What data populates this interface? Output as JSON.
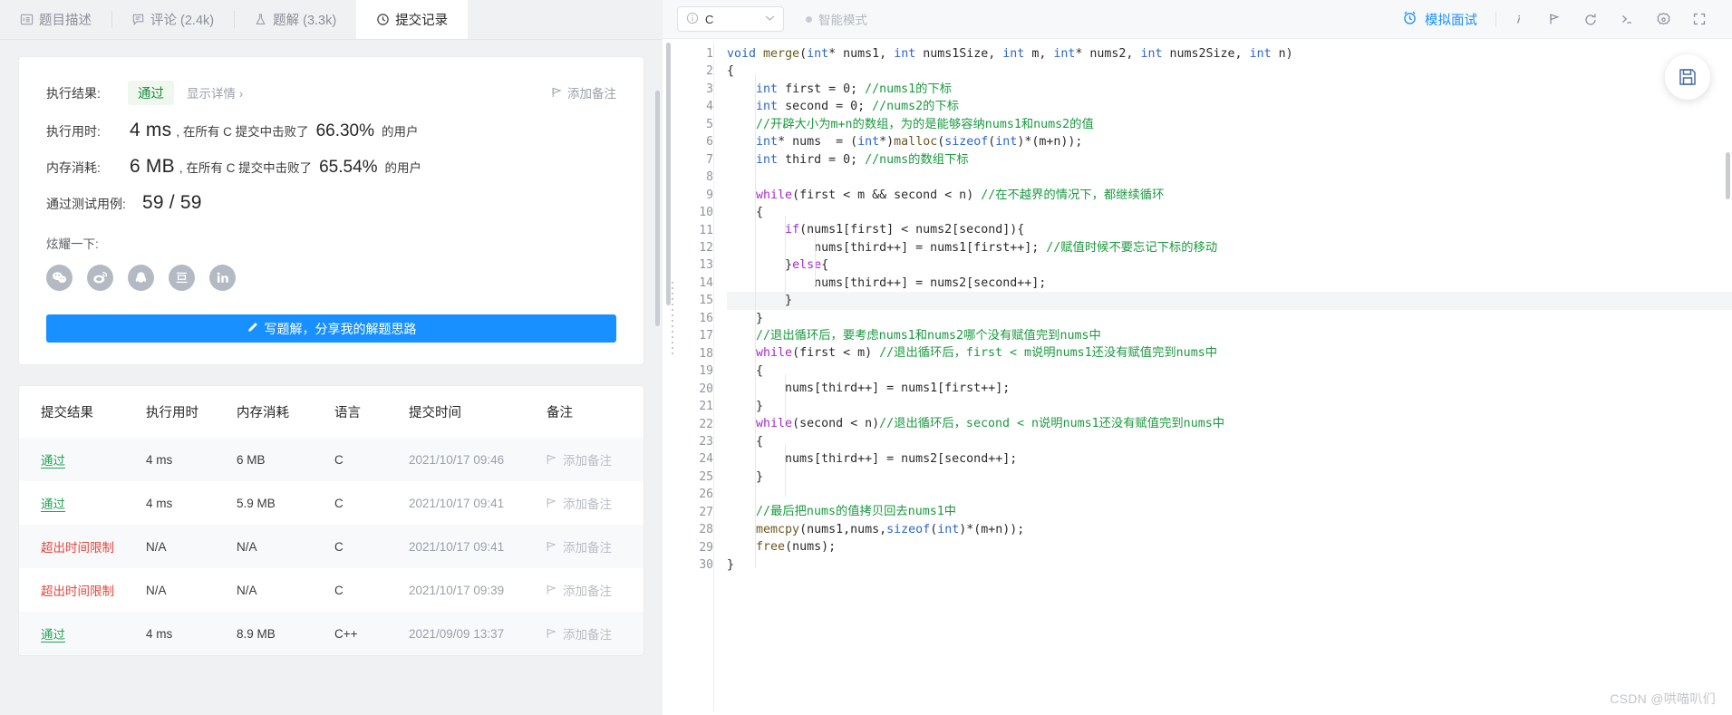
{
  "tabs": [
    {
      "label": "题目描述",
      "icon": "description-icon",
      "active": false
    },
    {
      "label": "评论 (2.4k)",
      "icon": "comment-icon",
      "active": false
    },
    {
      "label": "题解 (3.3k)",
      "icon": "flask-icon",
      "active": false
    },
    {
      "label": "提交记录",
      "icon": "clock-icon",
      "active": true
    }
  ],
  "result": {
    "exec_result_label": "执行结果:",
    "status": "通过",
    "show_detail": "显示详情 ›",
    "add_note": "添加备注",
    "runtime_label": "执行用时:",
    "runtime_value": "4 ms",
    "runtime_mid": ", 在所有 C 提交中击败了",
    "runtime_pct": "66.30%",
    "runtime_suffix": "的用户",
    "memory_label": "内存消耗:",
    "memory_value": "6 MB",
    "memory_mid": ", 在所有 C 提交中击败了",
    "memory_pct": "65.54%",
    "memory_suffix": "的用户",
    "testcase_label": "通过测试用例:",
    "testcase_value": "59 / 59",
    "share_label": "炫耀一下:",
    "share_icons": [
      "wechat-icon",
      "weibo-icon",
      "qq-icon",
      "douban-icon",
      "linkedin-icon"
    ],
    "write_solution_button": "写题解，分享我的解题思路"
  },
  "table": {
    "headers": [
      "提交结果",
      "执行用时",
      "内存消耗",
      "语言",
      "提交时间",
      "备注"
    ],
    "rows": [
      {
        "status": "通过",
        "status_type": "pass",
        "runtime": "4 ms",
        "memory": "6 MB",
        "lang": "C",
        "time": "2021/10/17 09:46",
        "note": "添加备注"
      },
      {
        "status": "通过",
        "status_type": "pass",
        "runtime": "4 ms",
        "memory": "5.9 MB",
        "lang": "C",
        "time": "2021/10/17 09:41",
        "note": "添加备注"
      },
      {
        "status": "超出时间限制",
        "status_type": "tle",
        "runtime": "N/A",
        "memory": "N/A",
        "lang": "C",
        "time": "2021/10/17 09:41",
        "note": "添加备注"
      },
      {
        "status": "超出时间限制",
        "status_type": "tle",
        "runtime": "N/A",
        "memory": "N/A",
        "lang": "C",
        "time": "2021/10/17 09:39",
        "note": "添加备注"
      },
      {
        "status": "通过",
        "status_type": "pass",
        "runtime": "4 ms",
        "memory": "8.9 MB",
        "lang": "C++",
        "time": "2021/09/09 13:37",
        "note": "添加备注"
      }
    ]
  },
  "editor_bar": {
    "language": "C",
    "smart_mode": "智能模式",
    "mock_interview": "模拟面试",
    "tools": [
      "info-icon",
      "flag-icon",
      "reset-icon",
      "console-icon",
      "settings-icon",
      "fullscreen-icon"
    ]
  },
  "code": {
    "first_line": 1,
    "last_line": 30,
    "highlighted_line": 15,
    "lines": [
      "void merge(int* nums1, int nums1Size, int m, int* nums2, int nums2Size, int n)",
      "{",
      "    int first = 0; //nums1的下标",
      "    int second = 0; //nums2的下标",
      "    //开辟大小为m+n的数组，为的是能够容纳nums1和nums2的值",
      "    int* nums  = (int*)malloc(sizeof(int)*(m+n));",
      "    int third = 0; //nums的数组下标",
      "",
      "    while(first < m && second < n) //在不越界的情况下，都继续循环",
      "    {",
      "        if(nums1[first] < nums2[second]){",
      "            nums[third++] = nums1[first++]; //赋值时候不要忘记下标的移动",
      "        }else{",
      "            nums[third++] = nums2[second++];",
      "        }",
      "    }",
      "    //退出循环后，要考虑nums1和nums2哪个没有赋值完到nums中",
      "    while(first < m) //退出循环后，first < m说明nums1还没有赋值完到nums中",
      "    {",
      "        nums[third++] = nums1[first++];",
      "    }",
      "    while(second < n)//退出循环后，second < n说明nums1还没有赋值完到nums中",
      "    {",
      "        nums[third++] = nums2[second++];",
      "    }",
      "",
      "    //最后把nums的值拷贝回去nums1中",
      "    memcpy(nums1,nums,sizeof(int)*(m+n));",
      "    free(nums);",
      "}"
    ]
  },
  "watermark": "CSDN @哄喵叭们",
  "colors": {
    "accent": "#1890ff",
    "pass": "#23a455",
    "fail": "#e8453c",
    "keyword": "#2c65d6",
    "control": "#a72ad0",
    "comment": "#1a9a3e"
  }
}
